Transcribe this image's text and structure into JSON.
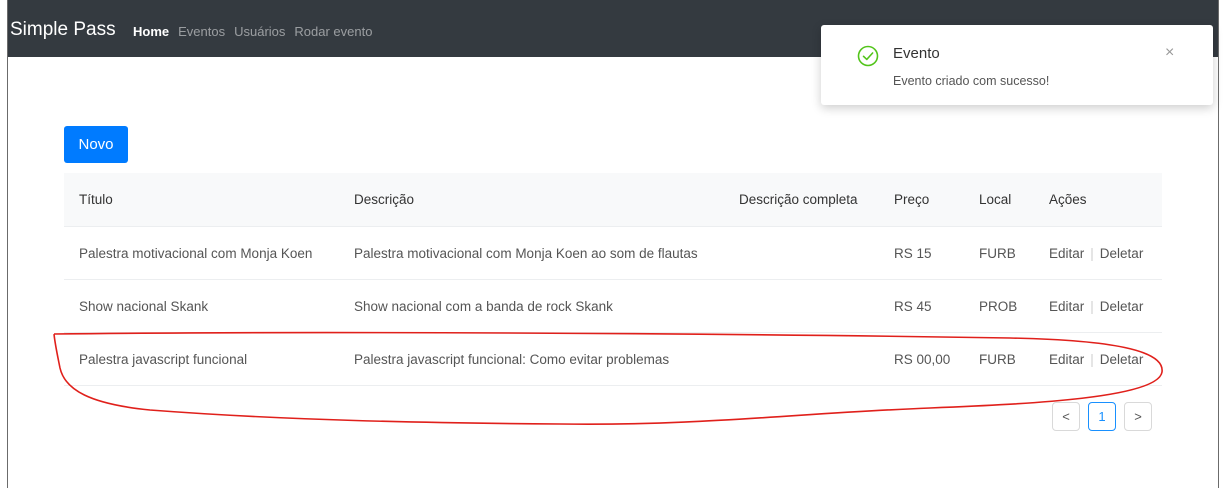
{
  "app": {
    "brand": "Simple Pass",
    "nav": [
      "Home",
      "Eventos",
      "Usuários",
      "Rodar evento"
    ]
  },
  "toolbar": {
    "new_label": "Novo"
  },
  "table": {
    "headers": [
      "Título",
      "Descrição",
      "Descrição completa",
      "Preço",
      "Local",
      "Ações"
    ],
    "rows": [
      {
        "titulo": "Palestra motivacional com Monja Koen",
        "descricao": "Palestra motivacional com Monja Koen ao som de flautas",
        "completa": "",
        "preco": "RS 15",
        "local": "FURB"
      },
      {
        "titulo": "Show nacional Skank",
        "descricao": "Show nacional com a banda de rock Skank",
        "completa": "",
        "preco": "RS 45",
        "local": "PROB"
      },
      {
        "titulo": "Palestra javascript funcional",
        "descricao": "Palestra javascript funcional: Como evitar problemas",
        "completa": "",
        "preco": "RS 00,00",
        "local": "FURB"
      }
    ],
    "actions": {
      "edit": "Editar",
      "delete": "Deletar"
    }
  },
  "pagination": {
    "prev": "<",
    "current": "1",
    "next": ">"
  },
  "toast": {
    "title": "Evento",
    "message": "Evento criado com sucesso!",
    "close": "×",
    "icon": "check-circle-icon",
    "color": "#52c41a"
  },
  "colors": {
    "navbar": "#343a40",
    "primary": "#007bff",
    "annotation": "#e0201b"
  }
}
